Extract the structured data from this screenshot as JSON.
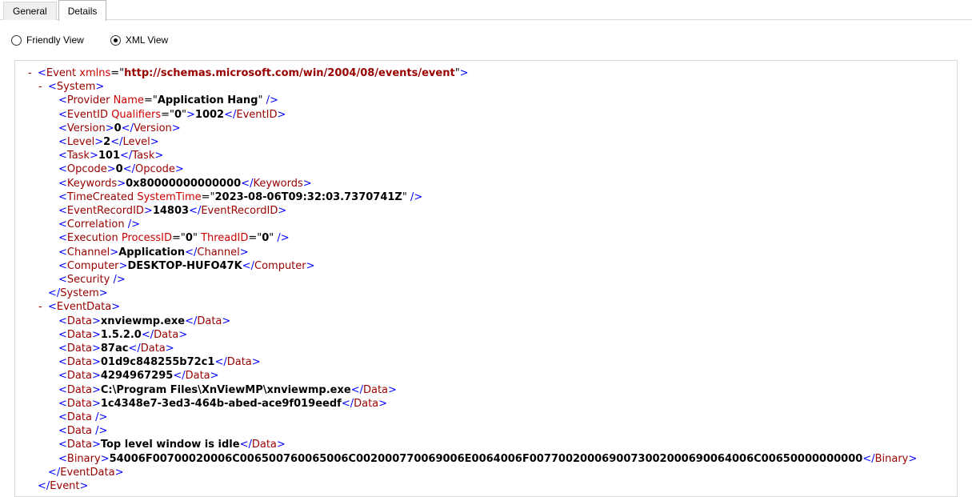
{
  "tabs": {
    "general": "General",
    "details": "Details",
    "active": "details"
  },
  "view_options": {
    "friendly": "Friendly View",
    "xml": "XML View",
    "selected": "xml"
  },
  "colors": {
    "punctuation": "#0000ff",
    "element_name": "#990000",
    "attribute_name": "#cc0000",
    "value_text": "#000000",
    "namespace_value": "#990000",
    "collapse_marker": "#990000",
    "tab_border": "#d9d9d9",
    "background": "#ffffff"
  },
  "xml": {
    "lines": [
      {
        "ind": 0,
        "marker": "-",
        "segs": [
          [
            "m",
            "<"
          ],
          [
            "e",
            "Event"
          ],
          [
            "k",
            " "
          ],
          [
            "a",
            "xmlns"
          ],
          [
            "k",
            "=\""
          ],
          [
            "n",
            "http://schemas.microsoft.com/win/2004/08/events/event"
          ],
          [
            "k",
            "\""
          ],
          [
            "m",
            ">"
          ]
        ]
      },
      {
        "ind": 1,
        "marker": "-",
        "segs": [
          [
            "m",
            "<"
          ],
          [
            "e",
            "System"
          ],
          [
            "m",
            ">"
          ]
        ]
      },
      {
        "ind": 2,
        "marker": "",
        "segs": [
          [
            "m",
            "<"
          ],
          [
            "e",
            "Provider"
          ],
          [
            "k",
            " "
          ],
          [
            "a",
            "Name"
          ],
          [
            "k",
            "=\""
          ],
          [
            "b",
            "Application Hang"
          ],
          [
            "k",
            "\" "
          ],
          [
            "m",
            "/>"
          ]
        ]
      },
      {
        "ind": 2,
        "marker": "",
        "segs": [
          [
            "m",
            "<"
          ],
          [
            "e",
            "EventID"
          ],
          [
            "k",
            " "
          ],
          [
            "a",
            "Qualifiers"
          ],
          [
            "k",
            "=\""
          ],
          [
            "b",
            "0"
          ],
          [
            "k",
            "\""
          ],
          [
            "m",
            ">"
          ],
          [
            "b",
            "1002"
          ],
          [
            "m",
            "</"
          ],
          [
            "e",
            "EventID"
          ],
          [
            "m",
            ">"
          ]
        ]
      },
      {
        "ind": 2,
        "marker": "",
        "segs": [
          [
            "m",
            "<"
          ],
          [
            "e",
            "Version"
          ],
          [
            "m",
            ">"
          ],
          [
            "b",
            "0"
          ],
          [
            "m",
            "</"
          ],
          [
            "e",
            "Version"
          ],
          [
            "m",
            ">"
          ]
        ]
      },
      {
        "ind": 2,
        "marker": "",
        "segs": [
          [
            "m",
            "<"
          ],
          [
            "e",
            "Level"
          ],
          [
            "m",
            ">"
          ],
          [
            "b",
            "2"
          ],
          [
            "m",
            "</"
          ],
          [
            "e",
            "Level"
          ],
          [
            "m",
            ">"
          ]
        ]
      },
      {
        "ind": 2,
        "marker": "",
        "segs": [
          [
            "m",
            "<"
          ],
          [
            "e",
            "Task"
          ],
          [
            "m",
            ">"
          ],
          [
            "b",
            "101"
          ],
          [
            "m",
            "</"
          ],
          [
            "e",
            "Task"
          ],
          [
            "m",
            ">"
          ]
        ]
      },
      {
        "ind": 2,
        "marker": "",
        "segs": [
          [
            "m",
            "<"
          ],
          [
            "e",
            "Opcode"
          ],
          [
            "m",
            ">"
          ],
          [
            "b",
            "0"
          ],
          [
            "m",
            "</"
          ],
          [
            "e",
            "Opcode"
          ],
          [
            "m",
            ">"
          ]
        ]
      },
      {
        "ind": 2,
        "marker": "",
        "segs": [
          [
            "m",
            "<"
          ],
          [
            "e",
            "Keywords"
          ],
          [
            "m",
            ">"
          ],
          [
            "b",
            "0x80000000000000"
          ],
          [
            "m",
            "</"
          ],
          [
            "e",
            "Keywords"
          ],
          [
            "m",
            ">"
          ]
        ]
      },
      {
        "ind": 2,
        "marker": "",
        "segs": [
          [
            "m",
            "<"
          ],
          [
            "e",
            "TimeCreated"
          ],
          [
            "k",
            " "
          ],
          [
            "a",
            "SystemTime"
          ],
          [
            "k",
            "=\""
          ],
          [
            "b",
            "2023-08-06T09:32:03.7370741Z"
          ],
          [
            "k",
            "\" "
          ],
          [
            "m",
            "/>"
          ]
        ]
      },
      {
        "ind": 2,
        "marker": "",
        "segs": [
          [
            "m",
            "<"
          ],
          [
            "e",
            "EventRecordID"
          ],
          [
            "m",
            ">"
          ],
          [
            "b",
            "14803"
          ],
          [
            "m",
            "</"
          ],
          [
            "e",
            "EventRecordID"
          ],
          [
            "m",
            ">"
          ]
        ]
      },
      {
        "ind": 2,
        "marker": "",
        "segs": [
          [
            "m",
            "<"
          ],
          [
            "e",
            "Correlation"
          ],
          [
            "k",
            " "
          ],
          [
            "m",
            "/>"
          ]
        ]
      },
      {
        "ind": 2,
        "marker": "",
        "segs": [
          [
            "m",
            "<"
          ],
          [
            "e",
            "Execution"
          ],
          [
            "k",
            " "
          ],
          [
            "a",
            "ProcessID"
          ],
          [
            "k",
            "=\""
          ],
          [
            "b",
            "0"
          ],
          [
            "k",
            "\" "
          ],
          [
            "a",
            "ThreadID"
          ],
          [
            "k",
            "=\""
          ],
          [
            "b",
            "0"
          ],
          [
            "k",
            "\" "
          ],
          [
            "m",
            "/>"
          ]
        ]
      },
      {
        "ind": 2,
        "marker": "",
        "segs": [
          [
            "m",
            "<"
          ],
          [
            "e",
            "Channel"
          ],
          [
            "m",
            ">"
          ],
          [
            "b",
            "Application"
          ],
          [
            "m",
            "</"
          ],
          [
            "e",
            "Channel"
          ],
          [
            "m",
            ">"
          ]
        ]
      },
      {
        "ind": 2,
        "marker": "",
        "segs": [
          [
            "m",
            "<"
          ],
          [
            "e",
            "Computer"
          ],
          [
            "m",
            ">"
          ],
          [
            "b",
            "DESKTOP-HUFO47K"
          ],
          [
            "m",
            "</"
          ],
          [
            "e",
            "Computer"
          ],
          [
            "m",
            ">"
          ]
        ]
      },
      {
        "ind": 2,
        "marker": "",
        "segs": [
          [
            "m",
            "<"
          ],
          [
            "e",
            "Security"
          ],
          [
            "k",
            " "
          ],
          [
            "m",
            "/>"
          ]
        ]
      },
      {
        "ind": 1,
        "marker": "",
        "segs": [
          [
            "m",
            "</"
          ],
          [
            "e",
            "System"
          ],
          [
            "m",
            ">"
          ]
        ]
      },
      {
        "ind": 1,
        "marker": "-",
        "segs": [
          [
            "m",
            "<"
          ],
          [
            "e",
            "EventData"
          ],
          [
            "m",
            ">"
          ]
        ]
      },
      {
        "ind": 2,
        "marker": "",
        "segs": [
          [
            "m",
            "<"
          ],
          [
            "e",
            "Data"
          ],
          [
            "m",
            ">"
          ],
          [
            "b",
            "xnviewmp.exe"
          ],
          [
            "m",
            "</"
          ],
          [
            "e",
            "Data"
          ],
          [
            "m",
            ">"
          ]
        ]
      },
      {
        "ind": 2,
        "marker": "",
        "segs": [
          [
            "m",
            "<"
          ],
          [
            "e",
            "Data"
          ],
          [
            "m",
            ">"
          ],
          [
            "b",
            "1.5.2.0"
          ],
          [
            "m",
            "</"
          ],
          [
            "e",
            "Data"
          ],
          [
            "m",
            ">"
          ]
        ]
      },
      {
        "ind": 2,
        "marker": "",
        "segs": [
          [
            "m",
            "<"
          ],
          [
            "e",
            "Data"
          ],
          [
            "m",
            ">"
          ],
          [
            "b",
            "87ac"
          ],
          [
            "m",
            "</"
          ],
          [
            "e",
            "Data"
          ],
          [
            "m",
            ">"
          ]
        ]
      },
      {
        "ind": 2,
        "marker": "",
        "segs": [
          [
            "m",
            "<"
          ],
          [
            "e",
            "Data"
          ],
          [
            "m",
            ">"
          ],
          [
            "b",
            "01d9c848255b72c1"
          ],
          [
            "m",
            "</"
          ],
          [
            "e",
            "Data"
          ],
          [
            "m",
            ">"
          ]
        ]
      },
      {
        "ind": 2,
        "marker": "",
        "segs": [
          [
            "m",
            "<"
          ],
          [
            "e",
            "Data"
          ],
          [
            "m",
            ">"
          ],
          [
            "b",
            "4294967295"
          ],
          [
            "m",
            "</"
          ],
          [
            "e",
            "Data"
          ],
          [
            "m",
            ">"
          ]
        ]
      },
      {
        "ind": 2,
        "marker": "",
        "segs": [
          [
            "m",
            "<"
          ],
          [
            "e",
            "Data"
          ],
          [
            "m",
            ">"
          ],
          [
            "b",
            "C:\\Program Files\\XnViewMP\\xnviewmp.exe"
          ],
          [
            "m",
            "</"
          ],
          [
            "e",
            "Data"
          ],
          [
            "m",
            ">"
          ]
        ]
      },
      {
        "ind": 2,
        "marker": "",
        "segs": [
          [
            "m",
            "<"
          ],
          [
            "e",
            "Data"
          ],
          [
            "m",
            ">"
          ],
          [
            "b",
            "1c4348e7-3ed3-464b-abed-ace9f019eedf"
          ],
          [
            "m",
            "</"
          ],
          [
            "e",
            "Data"
          ],
          [
            "m",
            ">"
          ]
        ]
      },
      {
        "ind": 2,
        "marker": "",
        "segs": [
          [
            "m",
            "<"
          ],
          [
            "e",
            "Data"
          ],
          [
            "k",
            " "
          ],
          [
            "m",
            "/>"
          ]
        ]
      },
      {
        "ind": 2,
        "marker": "",
        "segs": [
          [
            "m",
            "<"
          ],
          [
            "e",
            "Data"
          ],
          [
            "k",
            " "
          ],
          [
            "m",
            "/>"
          ]
        ]
      },
      {
        "ind": 2,
        "marker": "",
        "segs": [
          [
            "m",
            "<"
          ],
          [
            "e",
            "Data"
          ],
          [
            "m",
            ">"
          ],
          [
            "b",
            "Top level window is idle"
          ],
          [
            "m",
            "</"
          ],
          [
            "e",
            "Data"
          ],
          [
            "m",
            ">"
          ]
        ]
      },
      {
        "ind": 2,
        "marker": "",
        "segs": [
          [
            "m",
            "<"
          ],
          [
            "e",
            "Binary"
          ],
          [
            "m",
            ">"
          ],
          [
            "b",
            "54006F00700020006C006500760065006C002000770069006E0064006F0077002000690073002000690064006C00650000000000"
          ],
          [
            "m",
            "</"
          ],
          [
            "e",
            "Binary"
          ],
          [
            "m",
            ">"
          ]
        ]
      },
      {
        "ind": 1,
        "marker": "",
        "segs": [
          [
            "m",
            "</"
          ],
          [
            "e",
            "EventData"
          ],
          [
            "m",
            ">"
          ]
        ]
      },
      {
        "ind": 0,
        "marker": "",
        "segs": [
          [
            "m",
            "</"
          ],
          [
            "e",
            "Event"
          ],
          [
            "m",
            ">"
          ]
        ]
      }
    ]
  }
}
